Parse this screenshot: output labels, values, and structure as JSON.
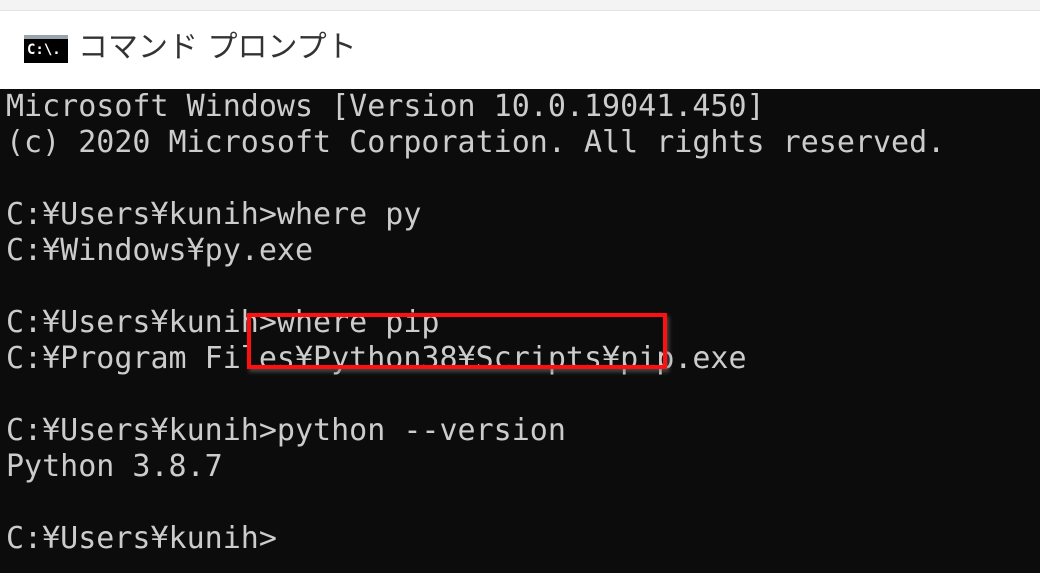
{
  "window": {
    "title": "コマンド プロンプト",
    "icon_label": "C:\\.",
    "icon": "command-prompt-icon"
  },
  "console": {
    "lines": [
      "Microsoft Windows [Version 10.0.19041.450]",
      "(c) 2020 Microsoft Corporation. All rights reserved.",
      "",
      "C:¥Users¥kunih>where py",
      "C:¥Windows¥py.exe",
      "",
      "C:¥Users¥kunih>where pip",
      "C:¥Program Files¥Python38¥Scripts¥pip.exe",
      "",
      "C:¥Users¥kunih>python --version",
      "Python 3.8.7",
      "",
      "C:¥Users¥kunih>"
    ]
  },
  "colors": {
    "console_background": "#0c0c0c",
    "console_text": "#cccccc",
    "highlight_border": "#ff0f0f",
    "titlebar_background": "#ffffff"
  }
}
